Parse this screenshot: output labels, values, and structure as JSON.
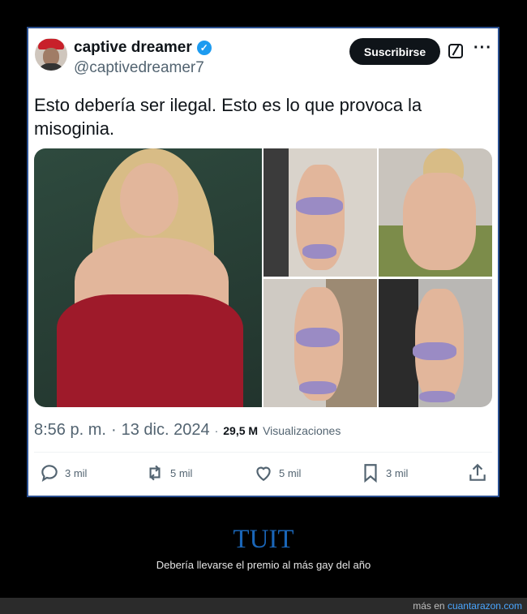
{
  "tweet": {
    "author": {
      "name": "captive dreamer",
      "handle": "@captivedreamer7",
      "verified": true
    },
    "subscribe_label": "Suscribirse",
    "text": "Esto debería ser ilegal. Esto es lo que provoca la misoginia.",
    "time": "8:56 p. m.",
    "separator": "·",
    "date": "13 dic. 2024",
    "views_separator": "·",
    "views": "29,5 M",
    "views_label": "Visualizaciones",
    "actions": {
      "replies": "3 mil",
      "retweets": "5 mil",
      "likes": "5 mil",
      "bookmarks": "3 mil"
    },
    "media_count": 5
  },
  "caption": {
    "title": "TUIT",
    "subtitle": "Debería llevarse el premio al más gay del año"
  },
  "footer": {
    "prefix": "más en",
    "link": "cuantarazon.com"
  },
  "colors": {
    "background": "#000000",
    "card_border": "#2a4f8f",
    "verified": "#1d9bf0",
    "caption_title": "#1a66b8",
    "link": "#4aa6ff"
  },
  "icons": [
    "verified-badge-icon",
    "grok-icon",
    "more-icon",
    "reply-icon",
    "retweet-icon",
    "like-icon",
    "bookmark-icon",
    "share-icon"
  ]
}
